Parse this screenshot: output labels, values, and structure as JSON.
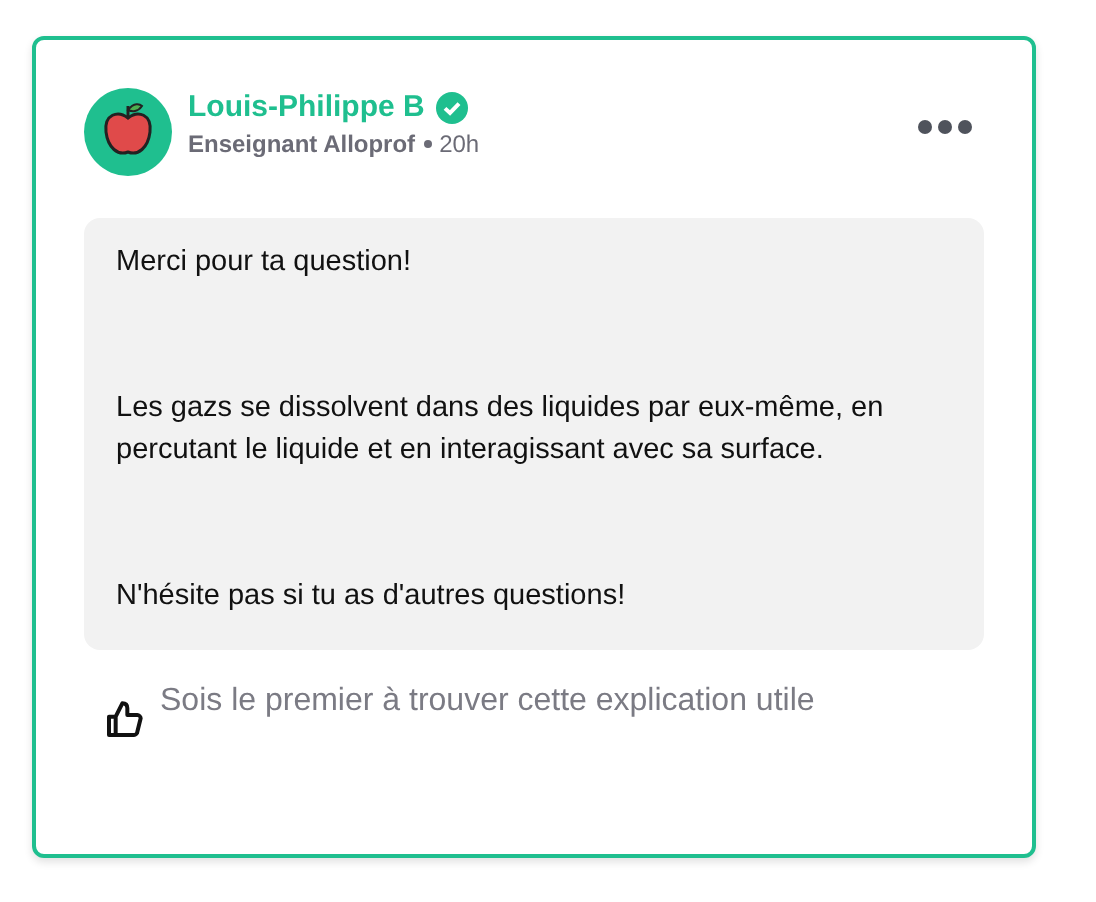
{
  "author": {
    "name": "Louis-Philippe B",
    "verified": true,
    "role": "Enseignant Alloprof",
    "time": "20h"
  },
  "message": {
    "paragraphs": [
      "Merci pour ta question!",
      "Les gazs se dissolvent dans des liquides par eux-même, en percutant le liquide et en interagissant avec sa surface.",
      "N'hésite pas si tu as d'autres questions!"
    ]
  },
  "footer": {
    "like_text": "Sois le premier à trouver cette explication utile"
  }
}
